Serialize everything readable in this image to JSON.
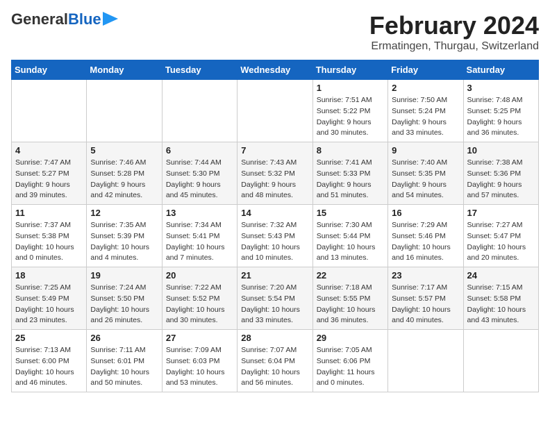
{
  "header": {
    "logo_general": "General",
    "logo_blue": "Blue",
    "month_title": "February 2024",
    "location": "Ermatingen, Thurgau, Switzerland"
  },
  "weekdays": [
    "Sunday",
    "Monday",
    "Tuesday",
    "Wednesday",
    "Thursday",
    "Friday",
    "Saturday"
  ],
  "weeks": [
    [
      {
        "day": "",
        "info": ""
      },
      {
        "day": "",
        "info": ""
      },
      {
        "day": "",
        "info": ""
      },
      {
        "day": "",
        "info": ""
      },
      {
        "day": "1",
        "info": "Sunrise: 7:51 AM\nSunset: 5:22 PM\nDaylight: 9 hours\nand 30 minutes."
      },
      {
        "day": "2",
        "info": "Sunrise: 7:50 AM\nSunset: 5:24 PM\nDaylight: 9 hours\nand 33 minutes."
      },
      {
        "day": "3",
        "info": "Sunrise: 7:48 AM\nSunset: 5:25 PM\nDaylight: 9 hours\nand 36 minutes."
      }
    ],
    [
      {
        "day": "4",
        "info": "Sunrise: 7:47 AM\nSunset: 5:27 PM\nDaylight: 9 hours\nand 39 minutes."
      },
      {
        "day": "5",
        "info": "Sunrise: 7:46 AM\nSunset: 5:28 PM\nDaylight: 9 hours\nand 42 minutes."
      },
      {
        "day": "6",
        "info": "Sunrise: 7:44 AM\nSunset: 5:30 PM\nDaylight: 9 hours\nand 45 minutes."
      },
      {
        "day": "7",
        "info": "Sunrise: 7:43 AM\nSunset: 5:32 PM\nDaylight: 9 hours\nand 48 minutes."
      },
      {
        "day": "8",
        "info": "Sunrise: 7:41 AM\nSunset: 5:33 PM\nDaylight: 9 hours\nand 51 minutes."
      },
      {
        "day": "9",
        "info": "Sunrise: 7:40 AM\nSunset: 5:35 PM\nDaylight: 9 hours\nand 54 minutes."
      },
      {
        "day": "10",
        "info": "Sunrise: 7:38 AM\nSunset: 5:36 PM\nDaylight: 9 hours\nand 57 minutes."
      }
    ],
    [
      {
        "day": "11",
        "info": "Sunrise: 7:37 AM\nSunset: 5:38 PM\nDaylight: 10 hours\nand 0 minutes."
      },
      {
        "day": "12",
        "info": "Sunrise: 7:35 AM\nSunset: 5:39 PM\nDaylight: 10 hours\nand 4 minutes."
      },
      {
        "day": "13",
        "info": "Sunrise: 7:34 AM\nSunset: 5:41 PM\nDaylight: 10 hours\nand 7 minutes."
      },
      {
        "day": "14",
        "info": "Sunrise: 7:32 AM\nSunset: 5:43 PM\nDaylight: 10 hours\nand 10 minutes."
      },
      {
        "day": "15",
        "info": "Sunrise: 7:30 AM\nSunset: 5:44 PM\nDaylight: 10 hours\nand 13 minutes."
      },
      {
        "day": "16",
        "info": "Sunrise: 7:29 AM\nSunset: 5:46 PM\nDaylight: 10 hours\nand 16 minutes."
      },
      {
        "day": "17",
        "info": "Sunrise: 7:27 AM\nSunset: 5:47 PM\nDaylight: 10 hours\nand 20 minutes."
      }
    ],
    [
      {
        "day": "18",
        "info": "Sunrise: 7:25 AM\nSunset: 5:49 PM\nDaylight: 10 hours\nand 23 minutes."
      },
      {
        "day": "19",
        "info": "Sunrise: 7:24 AM\nSunset: 5:50 PM\nDaylight: 10 hours\nand 26 minutes."
      },
      {
        "day": "20",
        "info": "Sunrise: 7:22 AM\nSunset: 5:52 PM\nDaylight: 10 hours\nand 30 minutes."
      },
      {
        "day": "21",
        "info": "Sunrise: 7:20 AM\nSunset: 5:54 PM\nDaylight: 10 hours\nand 33 minutes."
      },
      {
        "day": "22",
        "info": "Sunrise: 7:18 AM\nSunset: 5:55 PM\nDaylight: 10 hours\nand 36 minutes."
      },
      {
        "day": "23",
        "info": "Sunrise: 7:17 AM\nSunset: 5:57 PM\nDaylight: 10 hours\nand 40 minutes."
      },
      {
        "day": "24",
        "info": "Sunrise: 7:15 AM\nSunset: 5:58 PM\nDaylight: 10 hours\nand 43 minutes."
      }
    ],
    [
      {
        "day": "25",
        "info": "Sunrise: 7:13 AM\nSunset: 6:00 PM\nDaylight: 10 hours\nand 46 minutes."
      },
      {
        "day": "26",
        "info": "Sunrise: 7:11 AM\nSunset: 6:01 PM\nDaylight: 10 hours\nand 50 minutes."
      },
      {
        "day": "27",
        "info": "Sunrise: 7:09 AM\nSunset: 6:03 PM\nDaylight: 10 hours\nand 53 minutes."
      },
      {
        "day": "28",
        "info": "Sunrise: 7:07 AM\nSunset: 6:04 PM\nDaylight: 10 hours\nand 56 minutes."
      },
      {
        "day": "29",
        "info": "Sunrise: 7:05 AM\nSunset: 6:06 PM\nDaylight: 11 hours\nand 0 minutes."
      },
      {
        "day": "",
        "info": ""
      },
      {
        "day": "",
        "info": ""
      }
    ]
  ]
}
